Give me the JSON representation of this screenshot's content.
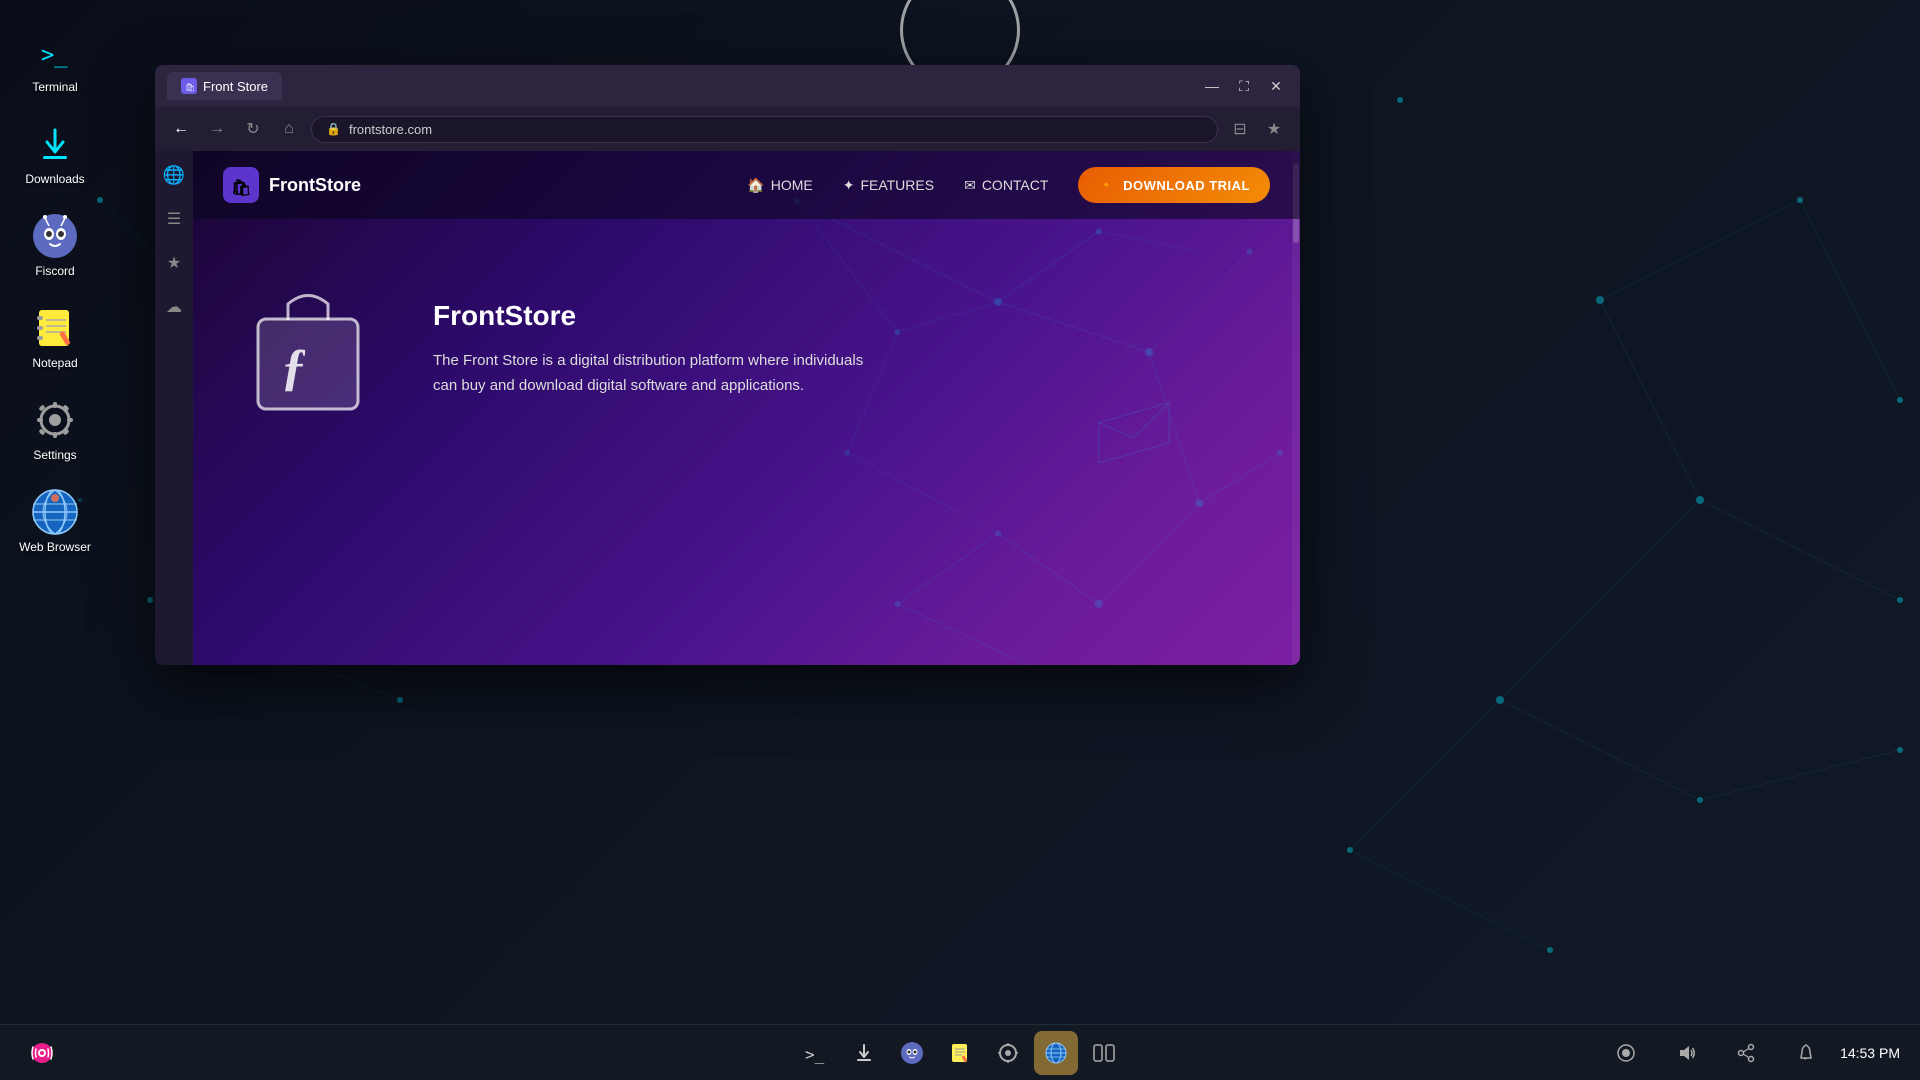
{
  "desktop": {
    "background": "#0a0e1a"
  },
  "taskbar_left_icons": [
    {
      "id": "terminal",
      "label": "Terminal",
      "icon": ">_",
      "type": "terminal"
    },
    {
      "id": "downloads",
      "label": "Downloads",
      "icon": "↓",
      "type": "downloads"
    },
    {
      "id": "fiscord",
      "label": "Fiscord",
      "icon": "👾",
      "type": "fiscord"
    },
    {
      "id": "notepad",
      "label": "Notepad",
      "icon": "📝",
      "type": "notepad"
    },
    {
      "id": "settings",
      "label": "Settings",
      "icon": "⚙",
      "type": "settings"
    },
    {
      "id": "webbrowser",
      "label": "Web Browser",
      "icon": "🌐",
      "type": "webbrowser"
    }
  ],
  "taskbar_bottom": {
    "left": {
      "podcast_icon": "🎙"
    },
    "center_icons": [
      {
        "id": "terminal-tb",
        "label": "Terminal"
      },
      {
        "id": "downloads-tb",
        "label": "Downloads"
      },
      {
        "id": "fiscord-tb",
        "label": "Fiscord"
      },
      {
        "id": "notepad-tb",
        "label": "Notepad"
      },
      {
        "id": "settings-tb",
        "label": "Settings"
      },
      {
        "id": "webbrowser-tb",
        "label": "Web Browser",
        "active": true
      },
      {
        "id": "splitview-tb",
        "label": "Split View"
      }
    ],
    "right": {
      "time": "14:53 PM",
      "sys_icons": [
        "🔴",
        "🔊",
        "🔗",
        "🔔"
      ]
    }
  },
  "browser": {
    "tab_title": "Front Store",
    "tab_icon": "🛍",
    "url": "frontstore.com",
    "window_title": "Front Store",
    "nav_controls": {
      "back": "←",
      "forward": "→",
      "refresh": "↻",
      "home": "⌂"
    },
    "titlebar_controls": {
      "minimize": "—",
      "maximize": "⛶",
      "close": "✕"
    }
  },
  "frontstore": {
    "brand": "FrontStore",
    "logo_char": "🛍",
    "nav": {
      "home": "HOME",
      "features": "FEATURES",
      "contact": "CONTACT",
      "cta_label": "DOWNLOAD TRIAL",
      "cta_icon": "🔸"
    },
    "hero": {
      "title": "FrontStore",
      "description": "The Front Store is a digital distribution platform where individuals can buy and download digital software and applications."
    }
  }
}
